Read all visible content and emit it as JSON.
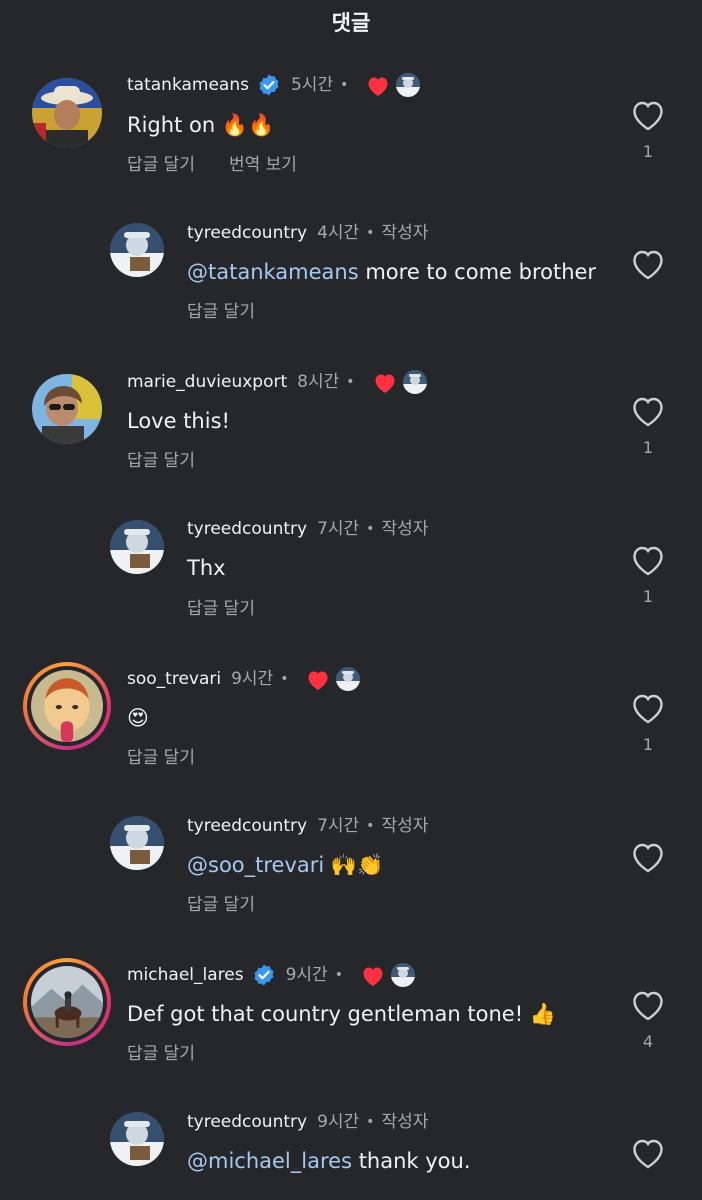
{
  "header": {
    "title": "댓글"
  },
  "labels": {
    "reply": "답글 달기",
    "translate": "번역 보기",
    "author": "작성자",
    "dot": "•"
  },
  "colors": {
    "background": "#25272b",
    "mention": "#a6c9f0",
    "verified": "#3897f0",
    "like_red": "#ff3040"
  },
  "comments": [
    {
      "username": "tatankameans",
      "verified": true,
      "time": "5시간",
      "author_liked": true,
      "text": "Right on 🔥🔥",
      "actions": [
        "답글 달기",
        "번역 보기"
      ],
      "likes": "1",
      "is_reply": false
    },
    {
      "username": "tyreedcountry",
      "verified": false,
      "time": "4시간",
      "is_author": true,
      "mention": "@tatankameans",
      "text": " more to come brother",
      "actions": [
        "답글 달기"
      ],
      "likes": "",
      "is_reply": true
    },
    {
      "username": "marie_duvieuxport",
      "verified": false,
      "time": "8시간",
      "author_liked": true,
      "text": "Love this!",
      "actions": [
        "답글 달기"
      ],
      "likes": "1",
      "is_reply": false
    },
    {
      "username": "tyreedcountry",
      "verified": false,
      "time": "7시간",
      "is_author": true,
      "text": "Thx",
      "actions": [
        "답글 달기"
      ],
      "likes": "1",
      "is_reply": true
    },
    {
      "username": "soo_trevari",
      "verified": false,
      "time": "9시간",
      "author_liked": true,
      "text": "😍",
      "actions": [
        "답글 달기"
      ],
      "likes": "1",
      "is_reply": false
    },
    {
      "username": "tyreedcountry",
      "verified": false,
      "time": "7시간",
      "is_author": true,
      "mention": "@soo_trevari",
      "text": " 🙌👏",
      "actions": [
        "답글 달기"
      ],
      "likes": "",
      "is_reply": true
    },
    {
      "username": "michael_lares",
      "verified": true,
      "time": "9시간",
      "author_liked": true,
      "text": "Def got that country gentleman tone! 👍",
      "actions": [
        "답글 달기"
      ],
      "likes": "4",
      "is_reply": false
    },
    {
      "username": "tyreedcountry",
      "verified": false,
      "time": "9시간",
      "is_author": true,
      "mention": "@michael_lares",
      "text": " thank you.",
      "actions": [],
      "likes": "",
      "is_reply": true
    }
  ]
}
